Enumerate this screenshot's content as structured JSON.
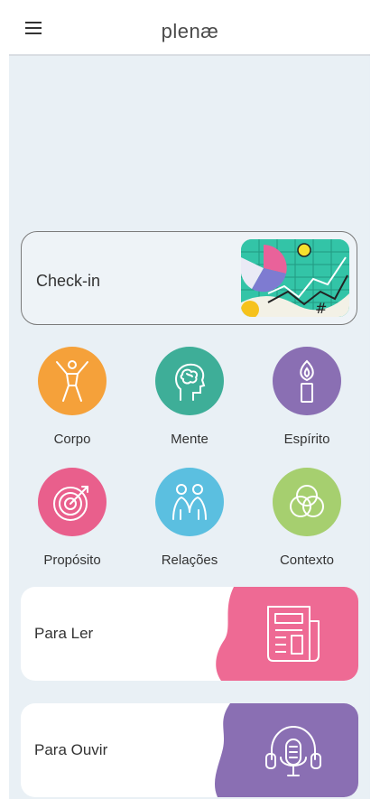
{
  "header": {
    "logo_text": "plenæ",
    "menu_icon": "hamburger-menu-icon"
  },
  "checkin": {
    "label": "Check-in",
    "art_icon": "chart-illustration-icon"
  },
  "dimensions": [
    {
      "label": "Corpo",
      "icon": "body-figure-icon",
      "color": "#f5a13a"
    },
    {
      "label": "Mente",
      "icon": "head-brain-icon",
      "color": "#3eae98"
    },
    {
      "label": "Espírito",
      "icon": "candle-icon",
      "color": "#8a6fb3"
    },
    {
      "label": "Propósito",
      "icon": "target-icon",
      "color": "#e95f8c"
    },
    {
      "label": "Relações",
      "icon": "people-icon",
      "color": "#5bbfe0"
    },
    {
      "label": "Contexto",
      "icon": "overlapping-circles-icon",
      "color": "#a6cf6f"
    }
  ],
  "cards": [
    {
      "label": "Para Ler",
      "icon": "newspaper-icon",
      "color": "#ee6a94"
    },
    {
      "label": "Para Ouvir",
      "icon": "headphones-mic-icon",
      "color": "#8a6fb3"
    }
  ]
}
